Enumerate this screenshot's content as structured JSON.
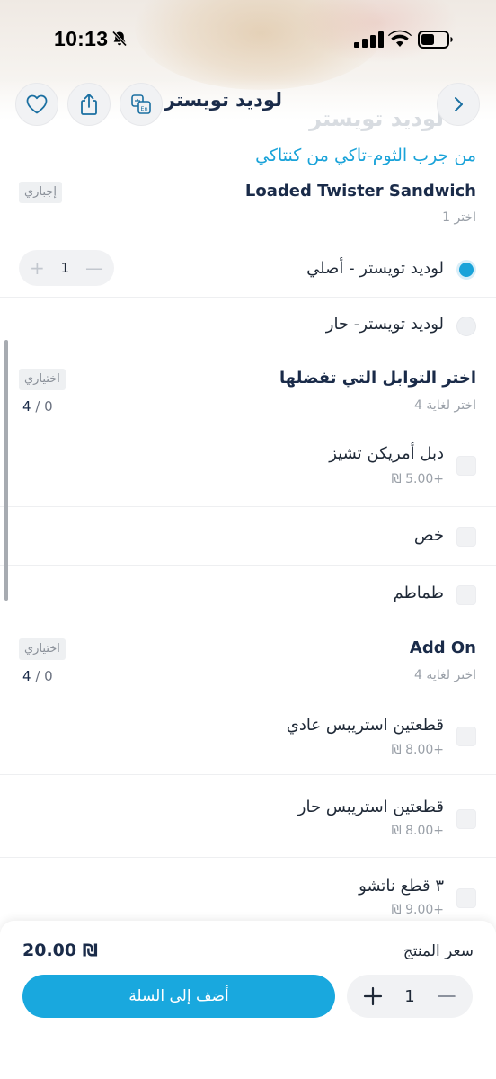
{
  "status_bar": {
    "time": "10:13"
  },
  "header": {
    "title": "لوديد تويستر",
    "ghost_title": "لوديد تويستر",
    "icons": {
      "favorite": "heart-icon",
      "share": "share-icon",
      "language": "translate-icon",
      "back": "chevron-right-icon"
    }
  },
  "product": {
    "subtitle": "من جرب الثوم-تاكي من كنتاكي"
  },
  "sections": [
    {
      "title": "Loaded Twister Sandwich",
      "tag": "إجباري",
      "hint": "اختر 1",
      "options": [
        {
          "label": "لوديد تويستر - أصلي",
          "selected": true,
          "quantity": "1",
          "minus": "—",
          "plus": "+"
        },
        {
          "label": "لوديد تويستر- حار",
          "selected": false
        }
      ]
    },
    {
      "title": "اختر التوابل التي تفضلها",
      "tag": "اختياري",
      "hint": "اختر لغاية 4",
      "counter_max": "4",
      "counter_sep": "/",
      "counter_current": "0",
      "options": [
        {
          "label": "دبل أمريكن تشيز",
          "price": "+5.00 ₪"
        },
        {
          "label": "خص"
        },
        {
          "label": "طماطم"
        }
      ]
    },
    {
      "title": "Add On",
      "tag": "اختياري",
      "hint": "اختر لغاية 4",
      "counter_max": "4",
      "counter_sep": "/",
      "counter_current": "0",
      "options": [
        {
          "label": "قطعتين استريبس  عادي",
          "price": "+8.00 ₪"
        },
        {
          "label": "قطعتين استريبس  حار",
          "price": "+8.00 ₪"
        },
        {
          "label": "٣ قطع ناتشو",
          "price": "+9.00 ₪"
        }
      ]
    }
  ],
  "footer": {
    "price_label": "سعر المنتج",
    "price_total": "20.00 ₪",
    "add_to_cart": "أضف إلى السلة",
    "quantity": "1",
    "minus": "—",
    "plus": "+"
  },
  "colors": {
    "accent": "#19a8de",
    "title": "#1a2b49",
    "muted": "#9aa0a8"
  }
}
